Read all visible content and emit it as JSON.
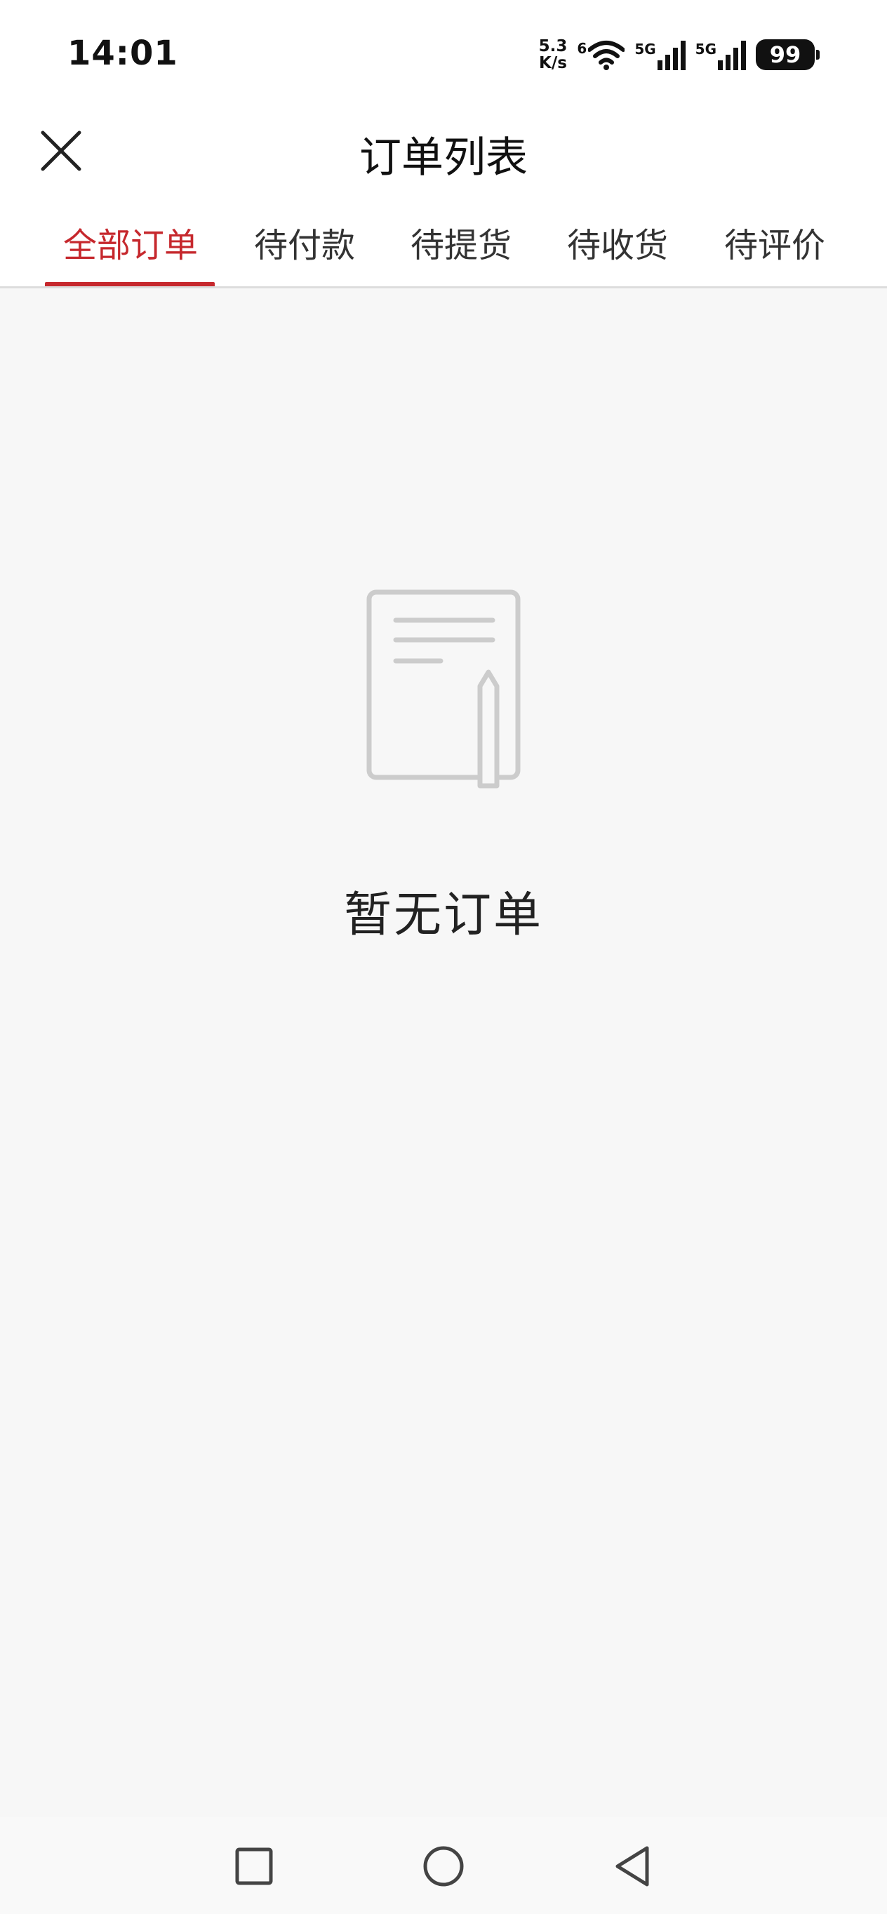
{
  "status_bar": {
    "time": "14:01",
    "net_speed_value": "5.3",
    "net_speed_unit": "K/s",
    "wifi_tag": "6",
    "signal1_tag": "5G",
    "signal2_tag": "5G",
    "battery": "99",
    "icons": [
      "wifi-icon",
      "signal-icon",
      "signal-icon",
      "battery-icon"
    ]
  },
  "header": {
    "title": "订单列表",
    "close_icon": "close-icon"
  },
  "tabs": [
    {
      "label": "全部订单",
      "active": true
    },
    {
      "label": "待付款",
      "active": false
    },
    {
      "label": "待提货",
      "active": false
    },
    {
      "label": "待收货",
      "active": false
    },
    {
      "label": "待评价",
      "active": false
    }
  ],
  "empty_state": {
    "icon": "document-pen-icon",
    "text": "暂无订单"
  },
  "nav_bar": {
    "icons": [
      "recents-square-icon",
      "home-circle-icon",
      "back-triangle-icon"
    ]
  },
  "colors": {
    "accent": "#c6282d",
    "background": "#f7f7f7",
    "header_bg": "#ffffff",
    "illustration": "#cccccc"
  }
}
